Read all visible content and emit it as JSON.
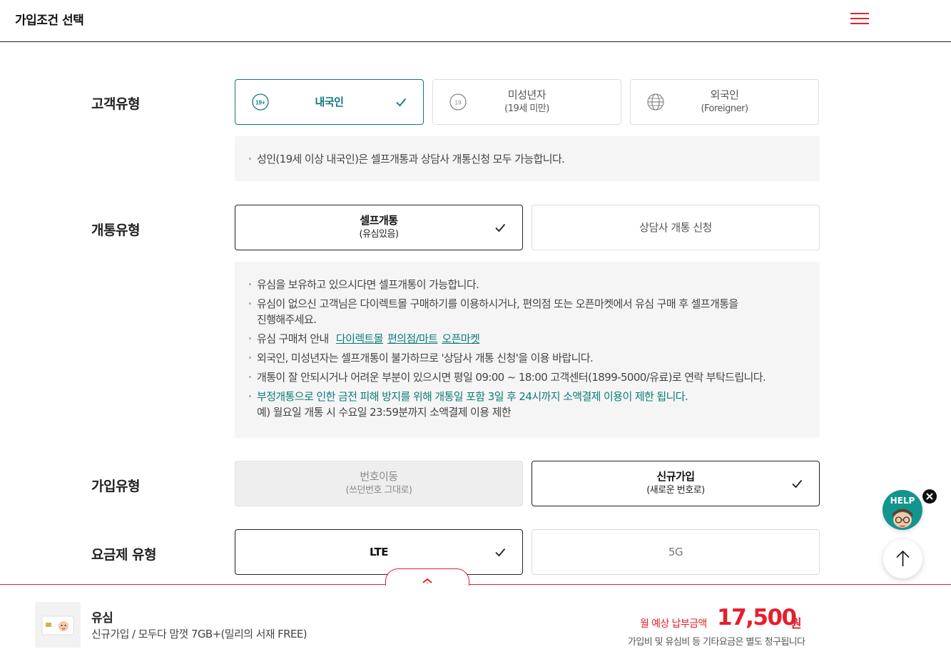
{
  "header": {
    "title": "가입조건 선택",
    "menu_icon": "hamburger-menu-icon"
  },
  "customer_type": {
    "label": "고객유형",
    "options": [
      {
        "main": "내국인",
        "sub": "",
        "selected": true
      },
      {
        "main": "미성년자",
        "sub": "(19세 미만)",
        "selected": false
      },
      {
        "main": "외국인",
        "sub": "(Foreigner)",
        "selected": false
      }
    ],
    "info": "성인(19세 이상 내국인)은 셀프개통과 상담사 개통신청 모두 가능합니다.",
    "icon_badge": "19+",
    "icon_badge_minor": "19"
  },
  "open_type": {
    "label": "개통유형",
    "options": [
      {
        "main": "셀프개통",
        "sub": "(유심있음)",
        "selected": true
      },
      {
        "main": "상담사 개통 신청",
        "sub": "",
        "selected": false
      }
    ],
    "info": [
      "유심을 보유하고 있으시다면 셀프개통이 가능합니다.",
      "유심이 없으신 고객님은 다이렉트몰 구매하기를 이용하시거나, 편의점 또는 오픈마켓에서 유심 구매 후 셀프개통을",
      "진행해주세요.",
      "유심 구매처 안내",
      "외국인, 미성년자는 셀프개통이 불가하므로 '상담사 개통 신청'을 이용 바랍니다.",
      "개통이 잘 안되시거나 어려운 부분이 있으시면 평일 09:00 ~ 18:00 고객센터(1899-5000/유료)로 연락 부탁드립니다.",
      "부정개통으로 인한 금전 피해 방지를 위해 개통일 포함 3일 후 24시까지 소액결제 이용이 제한 됩니다.",
      "예) 월요일 개통 시 수요일 23:59분까지 소액결제 이용 제한"
    ],
    "links": [
      "다이렉트몰",
      "편의점/마트",
      "오픈마켓"
    ]
  },
  "join_type": {
    "label": "가입유형",
    "options": [
      {
        "main": "번호이동",
        "sub": "(쓰던번호 그대로)",
        "selected": false,
        "disabled": true
      },
      {
        "main": "신규가입",
        "sub": "(새로운 번호로)",
        "selected": true
      }
    ]
  },
  "plan_type": {
    "label": "요금제 유형",
    "options": [
      {
        "main": "LTE",
        "selected": true
      },
      {
        "main": "5G",
        "selected": false
      }
    ]
  },
  "floating": {
    "help_label": "HELP"
  },
  "bottom": {
    "product_name": "유심",
    "product_desc": "신규가입 / 모두다 맘껏 7GB+(밀리의 서재 FREE)",
    "price_label": "월 예상 납부금액",
    "price": "17,500",
    "price_unit": "원",
    "price_note": "가입비 및 유심비 등 기타요금은 별도 청구됩니다"
  },
  "colors": {
    "accent_red": "#e4202e",
    "teal": "#0e7a7a",
    "help_bg": "#12958e"
  }
}
